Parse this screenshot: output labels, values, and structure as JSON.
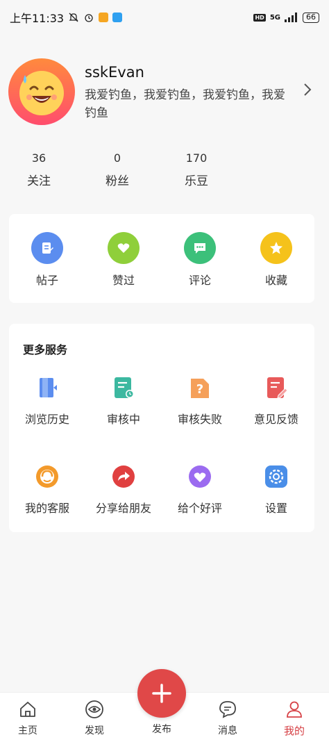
{
  "status_bar": {
    "time": "上午11:33",
    "network": "5G",
    "hd": "HD",
    "battery": "66"
  },
  "profile": {
    "username": "sskEvan",
    "bio": "我爱钓鱼，我爱钓鱼，我爱钓鱼，我爱钓鱼",
    "avatar_icon": "sweat-smile-emoji-icon"
  },
  "stats": [
    {
      "value": "36",
      "label": "关注"
    },
    {
      "value": "0",
      "label": "粉丝"
    },
    {
      "value": "170",
      "label": "乐豆"
    }
  ],
  "quick_actions": [
    {
      "label": "帖子",
      "icon": "post-icon",
      "color": "#5b8def"
    },
    {
      "label": "赞过",
      "icon": "heart-icon",
      "color": "#8fcf3a"
    },
    {
      "label": "评论",
      "icon": "comment-icon",
      "color": "#3cc07a"
    },
    {
      "label": "收藏",
      "icon": "star-icon",
      "color": "#f5c21b"
    }
  ],
  "services": {
    "title": "更多服务",
    "items": [
      {
        "label": "浏览历史",
        "icon": "history-icon"
      },
      {
        "label": "审核中",
        "icon": "reviewing-icon"
      },
      {
        "label": "审核失败",
        "icon": "review-failed-icon"
      },
      {
        "label": "意见反馈",
        "icon": "feedback-icon"
      },
      {
        "label": "我的客服",
        "icon": "customer-service-icon"
      },
      {
        "label": "分享给朋友",
        "icon": "share-icon"
      },
      {
        "label": "给个好评",
        "icon": "rate-heart-icon"
      },
      {
        "label": "设置",
        "icon": "settings-gear-icon"
      }
    ]
  },
  "bottom_nav": {
    "home": "主页",
    "discover": "发现",
    "publish": "发布",
    "messages": "消息",
    "mine": "我的"
  },
  "colors": {
    "accent": "#e04848",
    "active_tab": "#d64045"
  }
}
